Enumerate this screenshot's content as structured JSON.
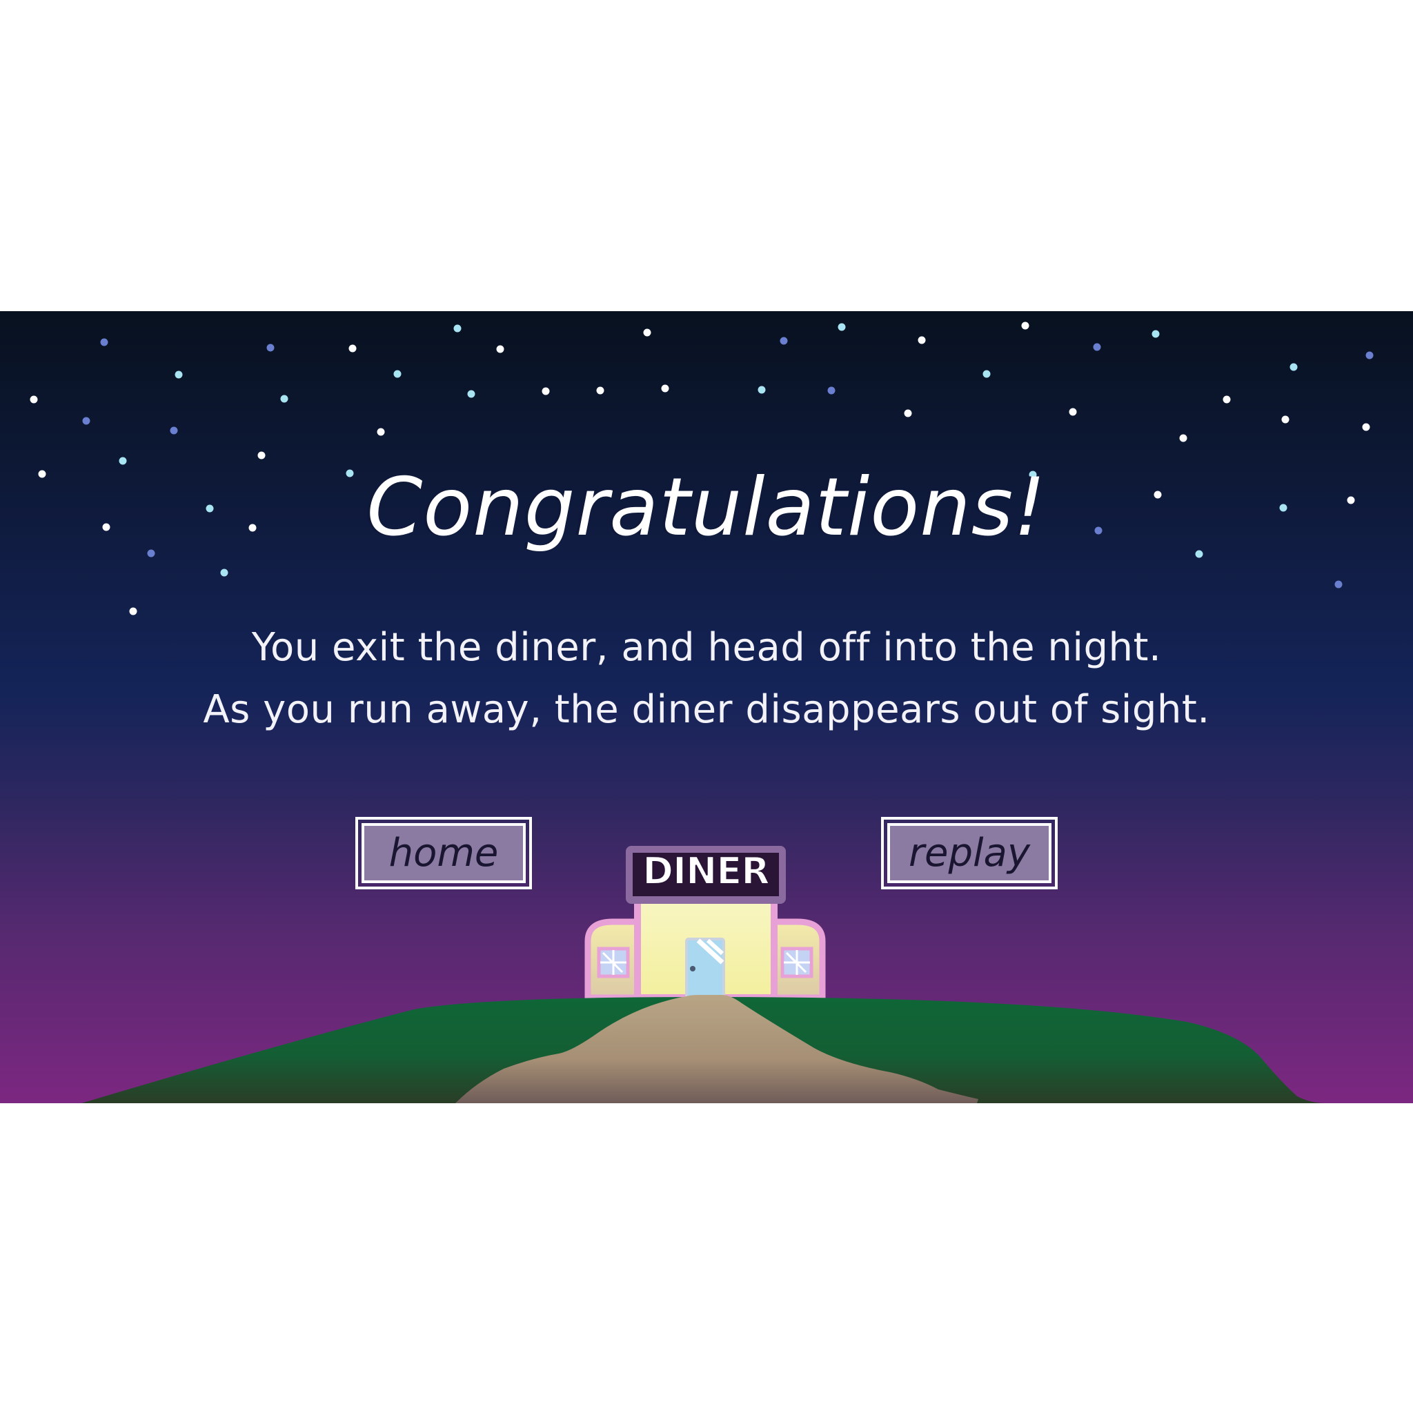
{
  "scene": {
    "title": "Congratulations!",
    "message_lines": [
      "You exit the diner, and head off into the night.",
      "As you run away, the diner disappears out of sight."
    ],
    "buttons": {
      "home_label": "home",
      "replay_label": "replay"
    },
    "diner_sign": "DINER"
  },
  "colors": {
    "sky_top": "#08111f",
    "sky_middle": "#142458",
    "sky_bottom": "#7c2781",
    "button_fill": "#8b7ba3",
    "hill": "#0f6637",
    "path": "#b09b80",
    "diner_wall": "#f6f4b6",
    "diner_trim": "#e7a1d6",
    "sign_bg": "#2a1537",
    "door": "#a9d8f0"
  },
  "icons": {
    "stars": "star-dots",
    "diner": "diner-building-illustration"
  }
}
